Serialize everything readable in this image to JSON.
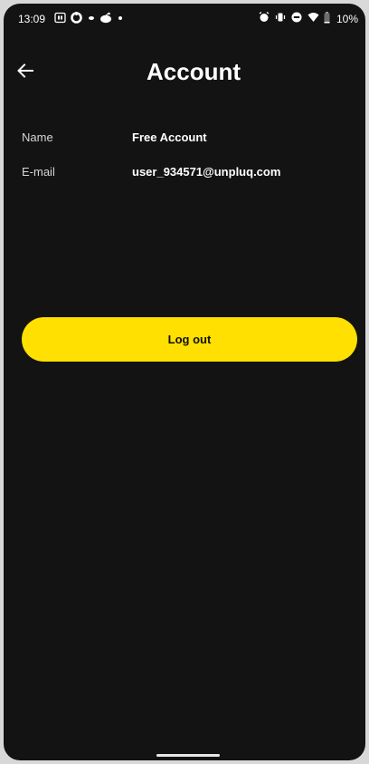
{
  "status_bar": {
    "time": "13:09",
    "battery": "10%",
    "left_icons": [
      "calendar-icon",
      "sync-icon",
      "cloud-icon",
      "reddit-icon",
      "dot-icon"
    ],
    "right_icons": [
      "alarm-icon",
      "vibrate-icon",
      "dnd-icon",
      "wifi-icon",
      "battery-icon"
    ]
  },
  "header": {
    "title": "Account",
    "back_icon": "arrow-left-icon"
  },
  "account": {
    "name_label": "Name",
    "name_value": "Free Account",
    "email_label": "E-mail",
    "email_value": "user_934571@unpluq.com"
  },
  "actions": {
    "logout_label": "Log out"
  },
  "colors": {
    "background": "#131313",
    "accent": "#ffe000",
    "text": "#ffffff"
  }
}
